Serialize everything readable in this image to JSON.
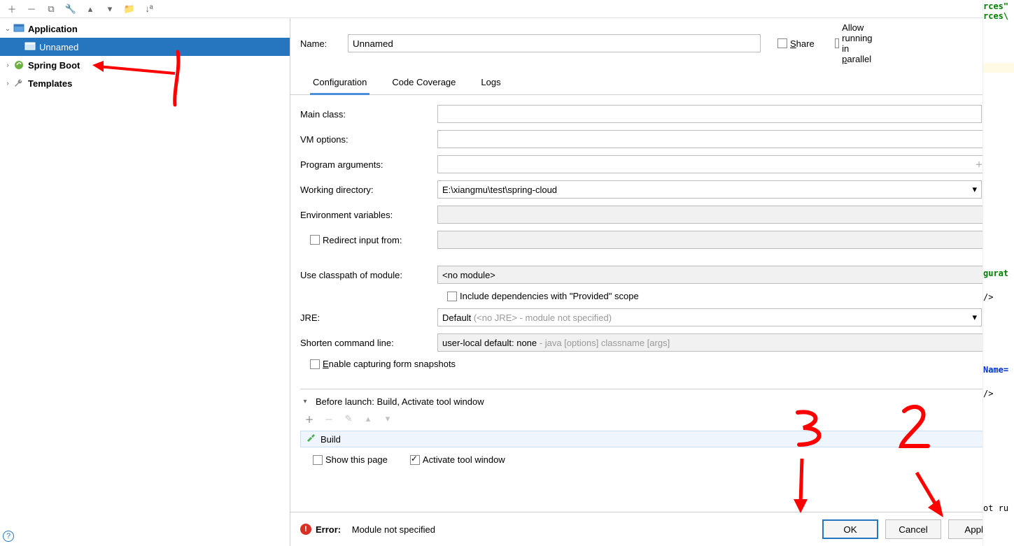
{
  "toolbar_icons": [
    "plus",
    "minus",
    "copy",
    "wrench",
    "up",
    "down",
    "folder",
    "sort"
  ],
  "tree": {
    "app_label": "Application",
    "unnamed_label": "Unnamed",
    "spring_label": "Spring Boot",
    "templates_label": "Templates"
  },
  "name": {
    "label": "Name:",
    "value": "Unnamed"
  },
  "share": "Share",
  "parallel": "Allow running in parallel",
  "tabs": {
    "config": "Configuration",
    "coverage": "Code Coverage",
    "logs": "Logs"
  },
  "form": {
    "main_class": "Main class:",
    "vm_options": "VM options:",
    "prog_args": "Program arguments:",
    "work_dir": "Working directory:",
    "work_dir_val": "E:\\xiangmu\\test\\spring-cloud",
    "env_vars": "Environment variables:",
    "redirect": "Redirect input from:",
    "classpath": "Use classpath of module:",
    "classpath_val": "<no module>",
    "include_provided": "Include dependencies with \"Provided\" scope",
    "jre": "JRE:",
    "jre_val_pre": "Default ",
    "jre_val_muted": "(<no JRE> - module not specified)",
    "shorten": "Shorten command line:",
    "shorten_val_pre": "user-local default: none ",
    "shorten_val_muted": "- java [options] classname [args]",
    "enable_snap": "Enable capturing form snapshots"
  },
  "before_launch": {
    "title": "Before launch: Build, Activate tool window",
    "build_item": "Build",
    "show_page": "Show this page",
    "activate": "Activate tool window"
  },
  "error": {
    "label": "Error:",
    "msg": "Module not specified"
  },
  "buttons": {
    "ok": "OK",
    "cancel": "Cancel",
    "apply": "Apply"
  },
  "code_snips": [
    "rces\"",
    "rces\\",
    "gurat",
    "/>",
    "Name=",
    "/>",
    "ot ru"
  ]
}
